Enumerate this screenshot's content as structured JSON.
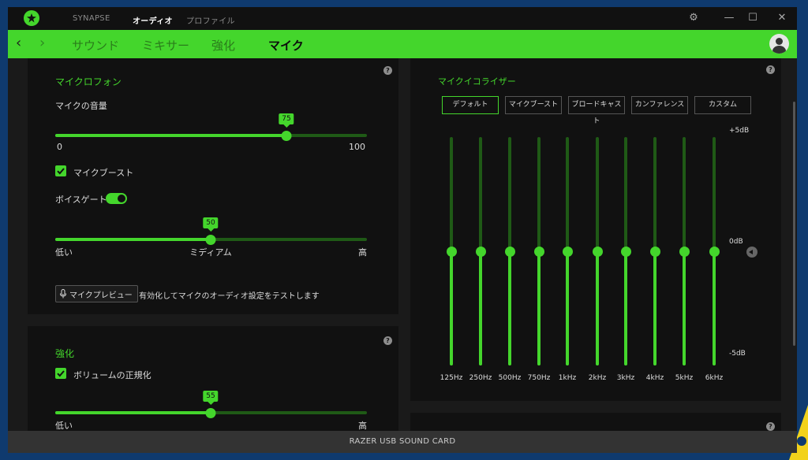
{
  "top_tabs": [
    "SYNAPSE",
    "オーディオ",
    "プロファイル"
  ],
  "sub_tabs": [
    "サウンド",
    "ミキサー",
    "強化",
    "マイク"
  ],
  "mic_panel": {
    "title": "マイクロフォン",
    "volume_label": "マイクの音量",
    "volume_value": "75",
    "volume_min": "0",
    "volume_max": "100",
    "mic_boost_label": "マイクブースト",
    "mic_boost_checked": true,
    "voice_gate_label": "ボイスゲート",
    "voice_gate_on": true,
    "gate_value": "50",
    "gate_low": "低い",
    "gate_mid": "ミディアム",
    "gate_high": "高",
    "preview_button": "マイクプレビュー",
    "preview_desc": "有効化してマイクのオーディオ設定をテストします"
  },
  "enhance_panel": {
    "title": "強化",
    "normalize_label": "ボリュームの正規化",
    "normalize_checked": true,
    "value": "55",
    "low": "低い",
    "high": "高"
  },
  "eq_panel": {
    "title": "マイクイコライザー",
    "presets": [
      "デフォルト",
      "マイクブースト",
      "ブロードキャスト",
      "カンファレンス",
      "カスタム"
    ],
    "active_preset": "デフォルト",
    "db_max": "+5dB",
    "db_mid": "0dB",
    "db_min": "-5dB",
    "bands": [
      {
        "freq": "125Hz",
        "gain": 0
      },
      {
        "freq": "250Hz",
        "gain": 0
      },
      {
        "freq": "500Hz",
        "gain": 0
      },
      {
        "freq": "750Hz",
        "gain": 0
      },
      {
        "freq": "1kHz",
        "gain": 0
      },
      {
        "freq": "2kHz",
        "gain": 0
      },
      {
        "freq": "3kHz",
        "gain": 0
      },
      {
        "freq": "4kHz",
        "gain": 0
      },
      {
        "freq": "5kHz",
        "gain": 0
      },
      {
        "freq": "6kHz",
        "gain": 0
      }
    ]
  },
  "help_glyph": "?",
  "status_bar": "RAZER USB SOUND CARD",
  "colors": {
    "accent": "#44d62c",
    "panel": "#111111",
    "background": "#1a1a1a"
  }
}
